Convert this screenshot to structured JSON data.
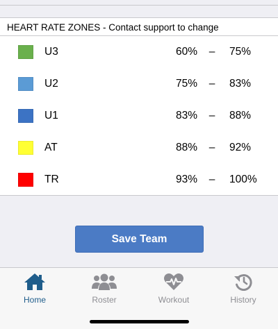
{
  "header": {
    "title": "HEART RATE ZONES - Contact support to change"
  },
  "zones": [
    {
      "name": "U3",
      "low": "60%",
      "dash": "–",
      "high": "75%",
      "color": "#6ab04c"
    },
    {
      "name": "U2",
      "low": "75%",
      "dash": "–",
      "high": "83%",
      "color": "#5b9bd5"
    },
    {
      "name": "U1",
      "low": "83%",
      "dash": "–",
      "high": "88%",
      "color": "#3c73c4"
    },
    {
      "name": "AT",
      "low": "88%",
      "dash": "–",
      "high": "92%",
      "color": "#ffff33"
    },
    {
      "name": "TR",
      "low": "93%",
      "dash": "–",
      "high": "100%",
      "color": "#ff0000"
    }
  ],
  "save_button": {
    "label": "Save Team",
    "color": "#4b7bc5"
  },
  "tabs": [
    {
      "label": "Home",
      "icon": "home-icon",
      "active": true
    },
    {
      "label": "Roster",
      "icon": "people-icon",
      "active": false
    },
    {
      "label": "Workout",
      "icon": "heart-pulse-icon",
      "active": false
    },
    {
      "label": "History",
      "icon": "history-icon",
      "active": false
    }
  ],
  "colors": {
    "active_tab": "#1f5d8b",
    "inactive_tab": "#8e8e93"
  }
}
